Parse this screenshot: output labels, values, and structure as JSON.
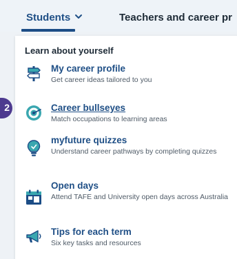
{
  "nav": {
    "students_label": "Students",
    "teachers_label": "Teachers and career pr"
  },
  "dropdown": {
    "section_heading": "Learn about yourself",
    "items": [
      {
        "title": "My career profile",
        "description": "Get career ideas tailored to you",
        "icon": "signpost-icon"
      },
      {
        "title": "Career bullseyes",
        "description": "Match occupations to learning areas",
        "icon": "bullseye-icon"
      },
      {
        "title": "myfuture quizzes",
        "description": "Understand career pathways by completing quizzes",
        "icon": "lightbulb-icon"
      },
      {
        "title": "Open days",
        "description": "Attend TAFE and University open days across Australia",
        "icon": "calendar-icon"
      },
      {
        "title": "Tips for each term",
        "description": "Six key tasks and resources",
        "icon": "megaphone-icon"
      }
    ]
  },
  "step_badge": "2",
  "colors": {
    "nav_link": "#1f4f86",
    "icon_teal": "#3aa7b0",
    "icon_navy": "#1c4d86",
    "badge": "#4d3a8f"
  }
}
